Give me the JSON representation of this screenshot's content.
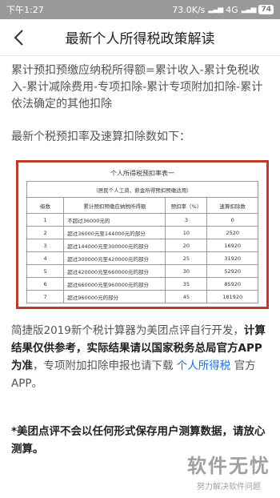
{
  "status_bar": {
    "time": "下午1:27",
    "speed": "73.0K/s",
    "network": "4G",
    "battery": "74"
  },
  "header": {
    "title": "最新个人所得税政策解读"
  },
  "content": {
    "formula": "累计预扣预缴应纳税所得额=累计收入-累计免税收入-累计减除费用-专项扣除-累计专项附加扣除-累计依法确定的其他扣除",
    "section_title": "最新个税预扣率及速算扣除数如下："
  },
  "table": {
    "title": "个人所得税预扣率表一",
    "subtitle": "（居民个人工资、薪金所得预扣预缴适用）",
    "headers": [
      "级数",
      "累计预扣预缴应纳税所得额",
      "预扣率（%）",
      "速算扣除数"
    ],
    "rows": [
      {
        "level": "1",
        "range": "不超过36000元的",
        "rate": "3",
        "deduction": "0"
      },
      {
        "level": "2",
        "range": "超过36000元至144000元的部分",
        "rate": "10",
        "deduction": "2520"
      },
      {
        "level": "3",
        "range": "超过144000元至300000元的部分",
        "rate": "20",
        "deduction": "16920"
      },
      {
        "level": "4",
        "range": "超过300000元至420000元的部分",
        "rate": "25",
        "deduction": "31920"
      },
      {
        "level": "5",
        "range": "超过420000元至660000元的部分",
        "rate": "30",
        "deduction": "52920"
      },
      {
        "level": "6",
        "range": "超过660000元至960000元的部分",
        "rate": "35",
        "deduction": "85920"
      },
      {
        "level": "7",
        "range": "超过960000元的部分",
        "rate": "45",
        "deduction": "181920"
      }
    ]
  },
  "disclaimer": {
    "part1": "简捷版2019新个税计算器为美团点评自行开发，",
    "bold": "计算结果仅供参考，实际结果请以国家税务总局官方APP为准",
    "part2": "，专项附加扣除申报也请下载 ",
    "link": "个人所得税",
    "part3": " 官方APP。"
  },
  "warning": "*美团点评不会以任何形式保存用户测算数据，请放心测算。",
  "watermark": {
    "title": "软件无忧",
    "subtitle": "努力解决软件问题"
  }
}
